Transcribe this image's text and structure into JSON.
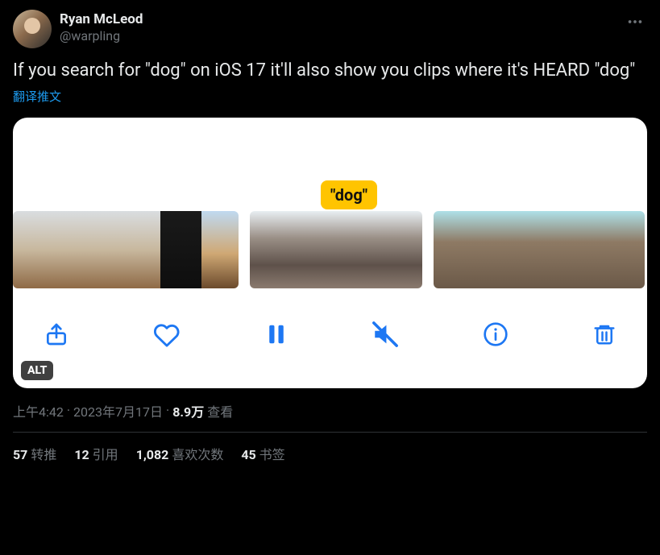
{
  "author": {
    "name": "Ryan McLeod",
    "handle": "@warpling"
  },
  "tweet_text": "If you search for \"dog\" on iOS 17 it'll also show you clips where it's HEARD \"dog\"",
  "translate_label": "翻译推文",
  "media": {
    "bubble": "\"dog\"",
    "alt_badge": "ALT"
  },
  "meta": {
    "time": "上午4:42",
    "sep1": " · ",
    "date": "2023年7月17日",
    "sep2": " · ",
    "views_count": "8.9万",
    "views_label": " 查看"
  },
  "stats": {
    "retweets": {
      "count": "57",
      "label": " 转推"
    },
    "quotes": {
      "count": "12",
      "label": " 引用"
    },
    "likes": {
      "count": "1,082",
      "label": " 喜欢次数"
    },
    "bookmarks": {
      "count": "45",
      "label": " 书签"
    }
  }
}
